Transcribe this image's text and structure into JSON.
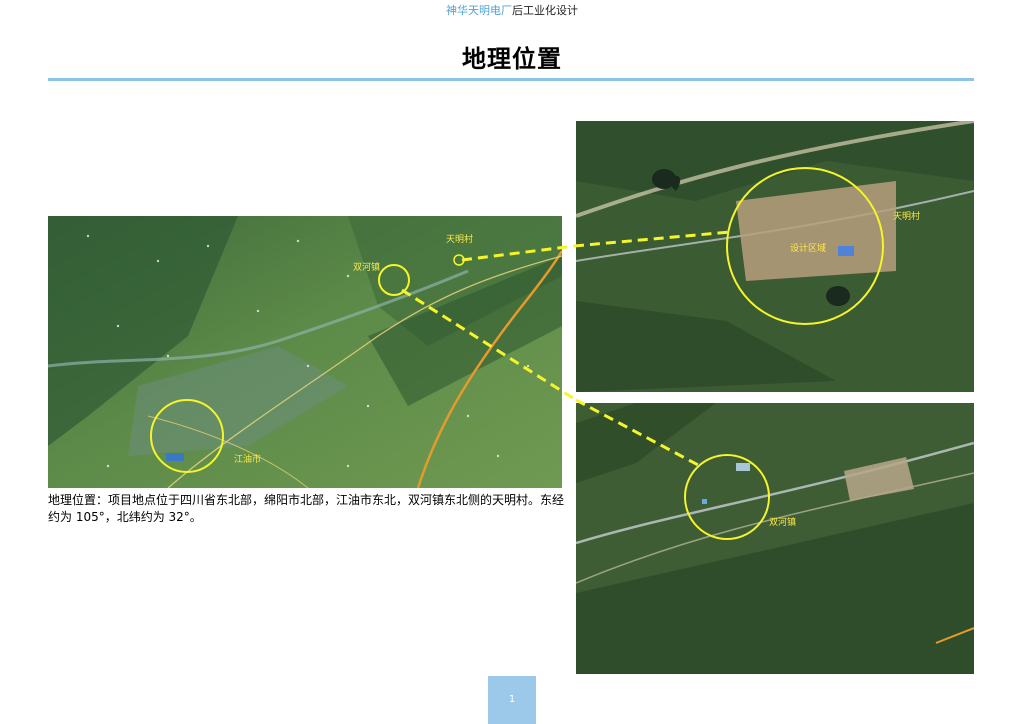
{
  "header": {
    "accent_text": "神华天明电厂",
    "plain_text": "后工业化设计"
  },
  "page_title": "地理位置",
  "main_map": {
    "labels": {
      "tianming_village": "天明村",
      "shuanghe_town": "双河镇",
      "jiangyou_city": "江油市"
    }
  },
  "aerial_top": {
    "labels": {
      "design_area": "设计区域",
      "tianming_village": "天明村"
    }
  },
  "aerial_bottom": {
    "labels": {
      "shuanghe_town": "双河镇"
    }
  },
  "caption": "地理位置：项目地点位于四川省东北部，绵阳市北部，江油市东北，双河镇东北侧的天明村。东经约为 105°，北纬约为 32°。",
  "page_number": "1",
  "colors": {
    "accent": "#4da3d6",
    "rule": "#8cc3e6",
    "highlight_circle": "#f5f52a",
    "page_number_bg": "#9cc8ea"
  }
}
